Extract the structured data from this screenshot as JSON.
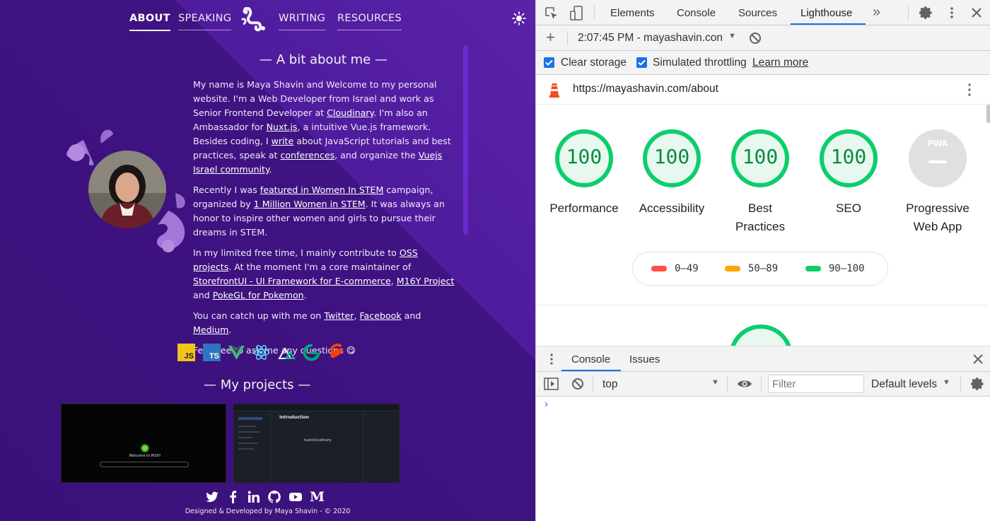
{
  "site": {
    "nav": {
      "about": "ABOUT",
      "speaking": "SPEAKING",
      "writing": "WRITING",
      "resources": "RESOURCES"
    },
    "about_title": "A bit about me",
    "bio": {
      "p1_a": "My name is Maya Shavin and Welcome to my personal website. I'm a Web Developer from Israel and work as Senior Frontend Developer at ",
      "p1_cloudinary": "Cloudinary",
      "p1_b": ". I'm also an Ambassador for ",
      "p1_nuxt": "Nuxt.js",
      "p1_c": ", a intuitive Vue.js framework. Besides coding, I ",
      "p1_write": "write",
      "p1_d": " about JavaScript tutorials and best practices, speak at ",
      "p1_conferences": "conferences",
      "p1_e": ", and organize the ",
      "p1_vuejs": "Vuejs Israel community",
      "p1_f": ".",
      "p2_a": "Recently I was ",
      "p2_featured": "featured in Women In STEM",
      "p2_b": " campaign, organized by ",
      "p2_million": "1 Million Women in STEM",
      "p2_c": ". It was always an honor to inspire other women and girls to pursue their dreams in STEM.",
      "p3_a": "In my limited free time, I mainly contribute to ",
      "p3_oss": "OSS projects",
      "p3_b": ". At the moment I'm a core maintainer of ",
      "p3_storefront": "StorefrontUI - UI Framework for E-commerce",
      "p3_c": ", ",
      "p3_m16y": "M16Y Project",
      "p3_d": " and ",
      "p3_pokegl": "PokeGL for Pokemon",
      "p3_e": ".",
      "p4_a": "You can catch up with me on ",
      "p4_twitter": "Twitter",
      "p4_b": ", ",
      "p4_facebook": "Facebook",
      "p4_c": " and ",
      "p4_medium": "Medium",
      "p4_d": ".",
      "p5": "Feel free to ask me any questions 😋"
    },
    "tech_icons": [
      "javascript-icon",
      "typescript-icon",
      "vue-icon",
      "react-icon",
      "nuxt-icon",
      "gridsome-icon",
      "svelte-icon"
    ],
    "tech_labels": {
      "js": "JS",
      "ts": "TS"
    },
    "projects_title": "My projects",
    "project1_caption": "Welcome to M16Y",
    "project2_caption": "nuxt/cloudinary",
    "project2_heading": "Introduction",
    "social_icons": [
      "twitter-icon",
      "facebook-icon",
      "linkedin-icon",
      "github-icon",
      "youtube-icon",
      "medium-icon"
    ],
    "footer": "Designed & Developed by Maya Shavin - © 2020"
  },
  "devtools": {
    "tabs": {
      "elements": "Elements",
      "console": "Console",
      "sources": "Sources",
      "lighthouse": "Lighthouse"
    },
    "report_select": "2:07:45 PM - mayashavin.con",
    "clear_storage": "Clear storage",
    "simulated_throttling": "Simulated throttling",
    "learn_more": "Learn more",
    "url": "https://mayashavin.com/about",
    "scores": [
      {
        "label": "Performance",
        "value": "100"
      },
      {
        "label": "Accessibility",
        "value": "100"
      },
      {
        "label": "Best Practices",
        "value": "100"
      },
      {
        "label": "SEO",
        "value": "100"
      },
      {
        "label": "Progressive Web App",
        "value": ""
      }
    ],
    "pwa_badge": "PWA",
    "legend": {
      "low": "0–49",
      "mid": "50–89",
      "high": "90–100"
    },
    "drawer_tabs": {
      "console": "Console",
      "issues": "Issues"
    },
    "context": "top",
    "filter_placeholder": "Filter",
    "levels": "Default levels",
    "colors": {
      "pass": "#0cce6b",
      "average": "#ffa400",
      "fail": "#ff4e42",
      "site_bg": "#4a1a94",
      "accent": "#1a73e8"
    }
  }
}
